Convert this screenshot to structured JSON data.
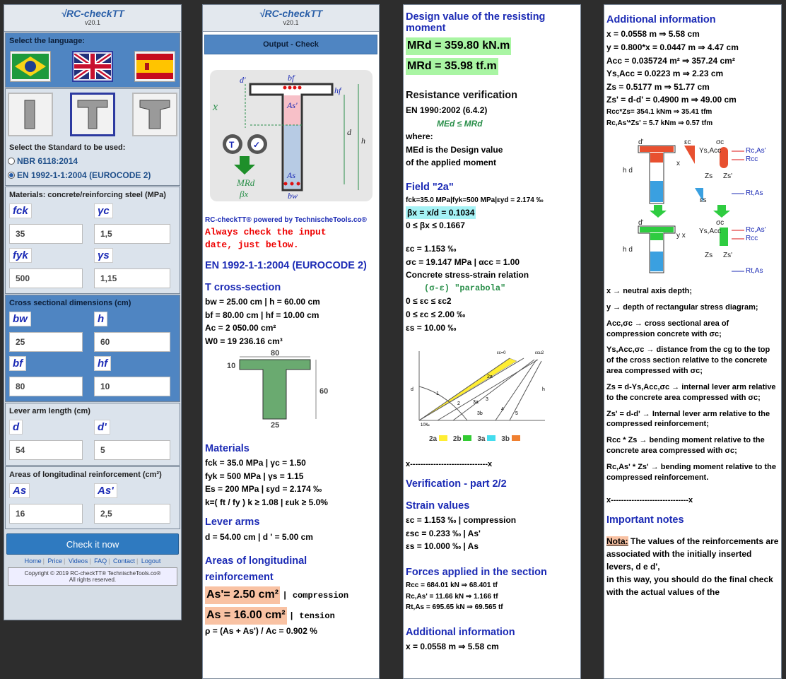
{
  "brand": {
    "logo": "√RC-checkTT",
    "version": "v20.1"
  },
  "col1": {
    "language_title": "Select the language:",
    "standard_title": "Select the Standard to be used:",
    "standards": [
      "NBR 6118:2014",
      "EN 1992-1-1:2004 (EUROCODE 2)"
    ],
    "materials_title": "Materials: concrete/reinforcing steel (MPa)",
    "fck_label": "fck",
    "fck": "35",
    "gc_label": "γc",
    "gc": "1,5",
    "fyk_label": "fyk",
    "fyk": "500",
    "gs_label": "γs",
    "gs": "1,15",
    "section_title": "Cross sectional dimensions (cm)",
    "bw_label": "bw",
    "bw": "25",
    "h_label": "h",
    "h": "60",
    "bf_label": "bf",
    "bf": "80",
    "hf_label": "hf",
    "hf": "10",
    "lever_title": "Lever arm length (cm)",
    "d_label": "d",
    "d": "54",
    "dp_label": "d'",
    "dp": "5",
    "areas_title": "Areas of longitudinal reinforcement (cm²)",
    "As_label": "As",
    "As": "16",
    "Asp_label": "As'",
    "Asp": "2,5",
    "check_button": "Check it now",
    "links": [
      "Home",
      "Price",
      "Videos",
      "FAQ",
      "Contact",
      "Logout"
    ],
    "copyright": "Copyright © 2019  RC-checkTT®  TechnischeTools.co®",
    "rights": "All rights reserved."
  },
  "col2": {
    "output_title": "Output - Check",
    "powered": "RC-checkTT® powered by TechnischeTools.co®",
    "warn1": "Always check the input",
    "warn2": "date, just below.",
    "standard": "EN 1992-1-1:2004 (EUROCODE 2)",
    "tsec_title": "T cross-section",
    "tsec_l1": "bw = 25.00 cm | h = 60.00 cm",
    "tsec_l2": "bf = 80.00 cm | hf = 10.00 cm",
    "tsec_l3": "Ac = 2 050.00 cm²",
    "tsec_l4": "W0 = 19 236.16 cm³",
    "dim_bf": "80",
    "dim_hf": "10",
    "dim_h": "60",
    "dim_bw": "25",
    "mat_title": "Materials",
    "mat_l1": "fck = 35.0 MPa | γc = 1.50",
    "mat_l2": "fyk = 500 MPa | γs = 1.15",
    "mat_l3": "Es = 200 MPa | εyd = 2.174 ‰",
    "mat_l4": "k=( ft / fy ) k ≥ 1.08 | εuk ≥ 5.0%",
    "lever_title": "Lever arms",
    "lever_l1": "d = 54.00 cm | d ' = 5.00 cm",
    "areas_title": "Areas of longitudinal reinforcement",
    "areas_l1": "As'= 2.50 cm²",
    "areas_l1b": "| compression",
    "areas_l2": "As = 16.00 cm²",
    "areas_l2b": "| tension",
    "areas_l3": "ρ = (As + As') / Ac = 0.902 %"
  },
  "col3": {
    "design_title": "Design value of the resisting moment",
    "mrd1": "MRd = 359.80 kN.m",
    "mrd2": "MRd = 35.98 tf.m",
    "resist_title": "Resistance verification",
    "resist_l1": "EN 1990:2002 (6.4.2)",
    "resist_l2": "MEd ≤ MRd",
    "resist_l3": "where:",
    "resist_l4": "MEd is the Design value",
    "resist_l5": "of the applied moment",
    "field_title": "Field \"2a\"",
    "field_l1": "fck=35.0 MPa|fyk=500 MPa|εyd = 2.174 ‰",
    "field_l2": "βx = x/d = 0.1034",
    "field_l3": "0 ≤ βx ≤ 0.1667",
    "field_l4": "εc = 1.153 ‰",
    "field_l5": "σc = 19.147 MPa | αcc = 1.00",
    "field_l6": "Concrete stress-strain relation",
    "field_l7": "(σ-ε) \"parabola\"",
    "field_l8": "0 ≤ εc ≤ εc2",
    "field_l9": "0 ≤ εc ≤ 2.00 ‰",
    "field_l10": "εs = 10.00 ‰",
    "legend": [
      "2a",
      "2b",
      "3a",
      "3b"
    ],
    "sep": "x------------------------------x",
    "verif_title": "Verification - part 2/2",
    "strain_title": "Strain values",
    "strain_l1": "εc = 1.153 ‰ | compression",
    "strain_l2": "εsc = 0.233 ‰ | As'",
    "strain_l3": "εs = 10.000 ‰ | As",
    "forces_title": "Forces applied in the section",
    "forces_l1": "Rcc = 684.01 kN ⇒ 68.401 tf",
    "forces_l2": "Rc,As' = 11.66 kN ⇒ 1.166 tf",
    "forces_l3": "Rt,As = 695.65 kN ⇒ 69.565 tf",
    "add_title": "Additional information",
    "add_l1": "x = 0.0558 m ⇒ 5.58 cm"
  },
  "col4": {
    "add_title": "Additional information",
    "l1": "x = 0.0558 m ⇒ 5.58 cm",
    "l2": "y = 0.800*x = 0.0447 m ⇒ 4.47 cm",
    "l3": "Acc = 0.035724 m² ⇒ 357.24 cm²",
    "l4": "Ys,Acc = 0.0223 m ⇒ 2.23 cm",
    "l5": "Zs = 0.5177 m ⇒ 51.77 cm",
    "l6": "Zs' = d-d' = 0.4900 m ⇒ 49.00 cm",
    "l7": "Rcc*Zs= 354.1 kNm ⇒ 35.41 tfm",
    "l8": "Rc,As'*Zs' = 5.7 kNm ⇒ 0.57 tfm",
    "n1": "x → neutral axis depth;",
    "n2": "y → depth of rectangular stress diagram;",
    "n3": "Acc,σc → cross sectional area of compression concrete with σc;",
    "n4": "Ys,Acc,σc → distance from the cg to the top of the cross section relative to the concrete area compressed with σc;",
    "n5": "Zs = d-Ys,Acc,σc → internal lever arm relative to the concrete area compressed with σc;",
    "n6": "Zs' = d-d' → Internal lever arm relative to the compressed reinforcement;",
    "n7": "Rcc * Zs → bending moment relative to the concrete area compressed with σc;",
    "n8": "Rc,As' * Zs' → bending moment relative to the compressed reinforcement.",
    "sep": "x------------------------------x",
    "imp_title": "Important notes",
    "nota_label": "Nota:",
    "nota_text": "The values of the reinforcements are associated with the initially inserted levers, d e d',",
    "nota_text2": "in this way, you should do the final check with the actual values of the"
  }
}
